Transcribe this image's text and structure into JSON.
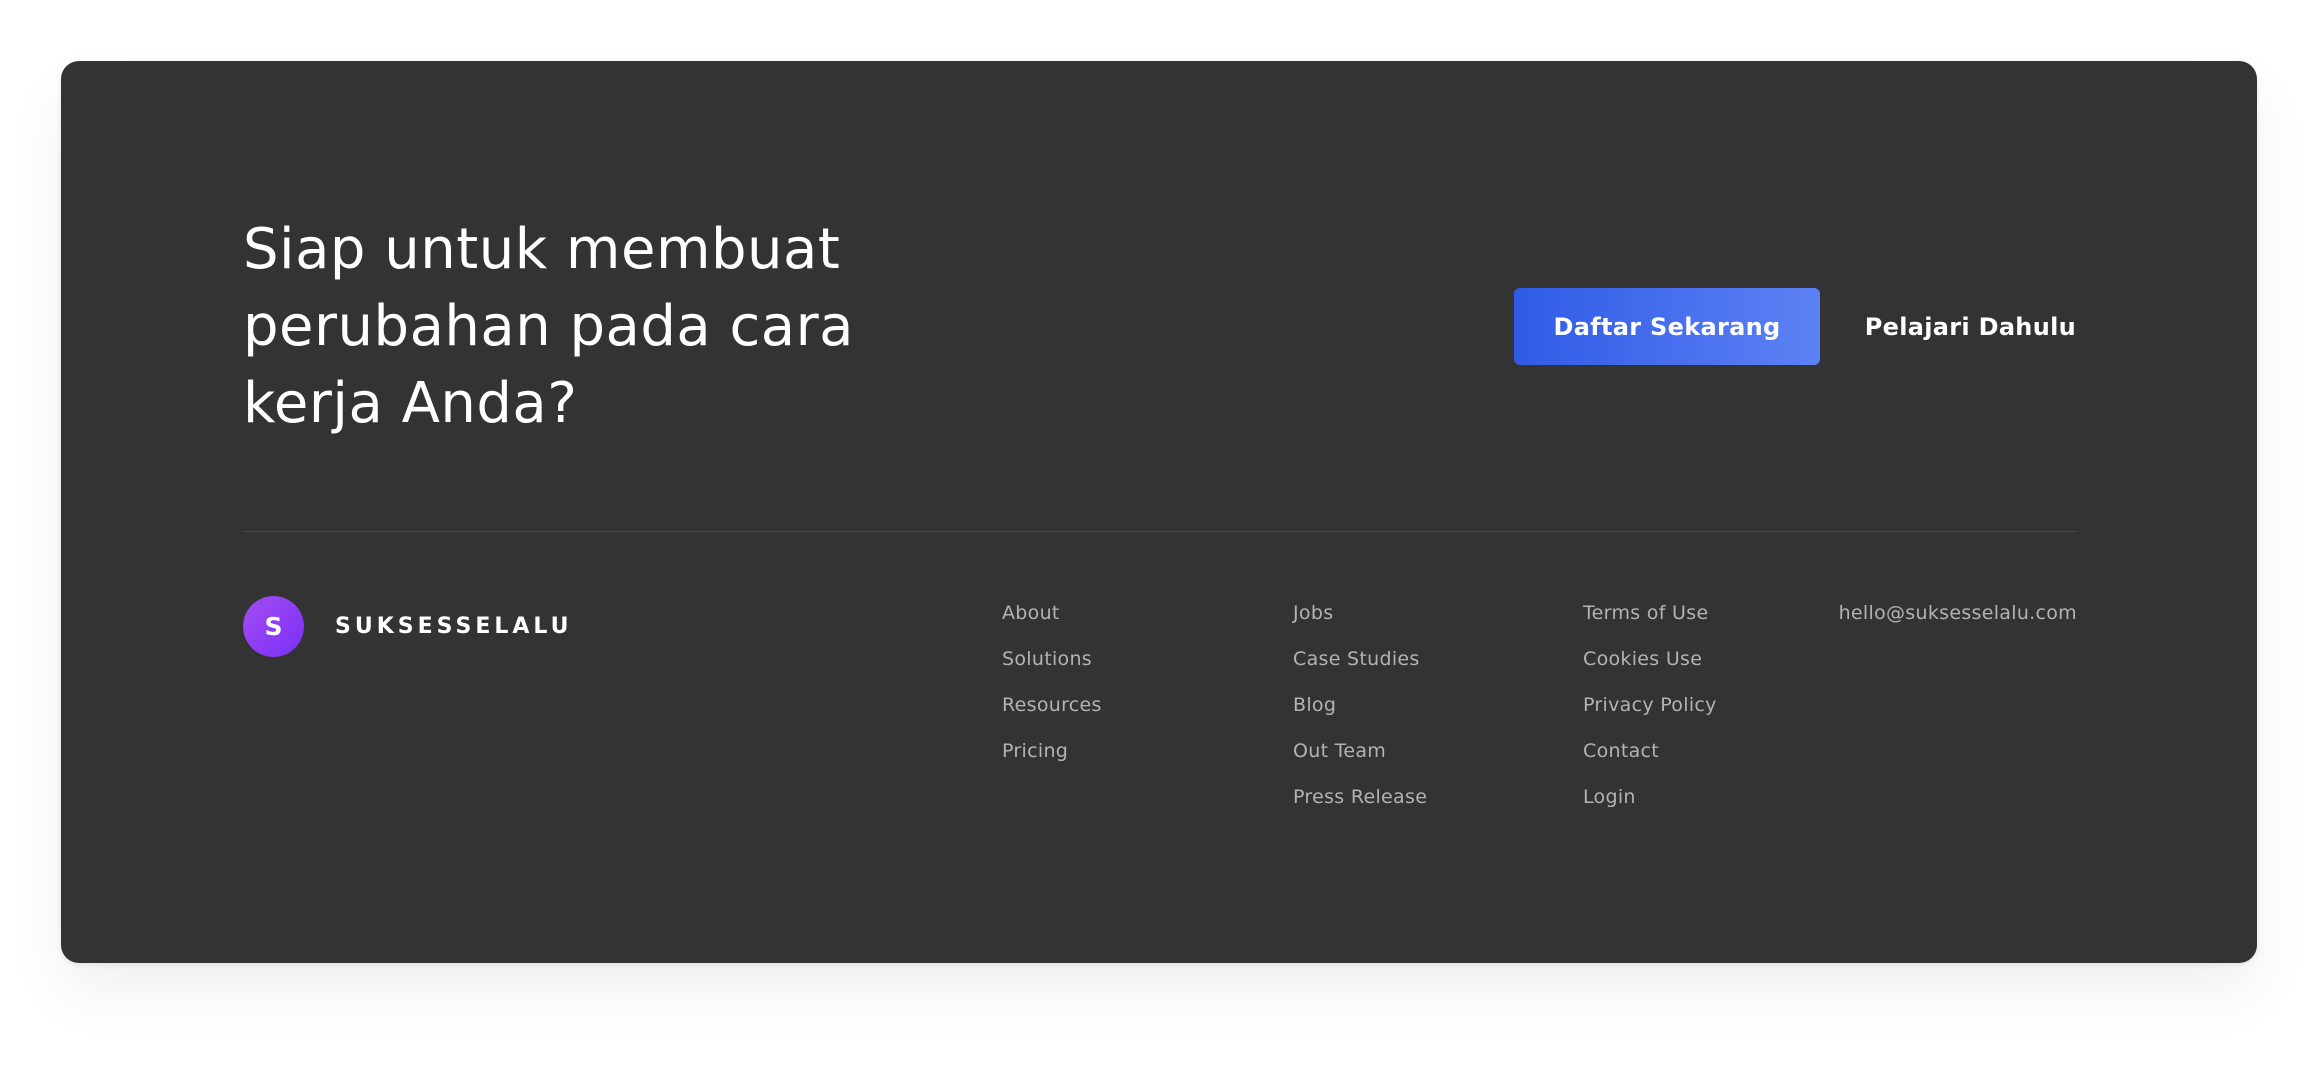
{
  "colors": {
    "page_background": "#ffffff",
    "card_background": "#333333",
    "primary_button_start": "#2f5be6",
    "primary_button_end": "#5d82f5",
    "logo_start": "#a24df2",
    "logo_end": "#7b2ff7",
    "link_text": "#b3b3b3",
    "heading_text": "#ffffff"
  },
  "cta": {
    "heading_lines": [
      "Siap untuk membuat",
      "perubahan pada cara",
      "kerja Anda?"
    ],
    "primary_button_label": "Daftar Sekarang",
    "secondary_link_label": "Pelajari Dahulu"
  },
  "brand": {
    "logo_letter": "S",
    "name": "SUKSESSELALU"
  },
  "footer": {
    "columns": [
      {
        "links": [
          "About",
          "Solutions",
          "Resources",
          "Pricing"
        ]
      },
      {
        "links": [
          "Jobs",
          "Case Studies",
          "Blog",
          "Out Team",
          "Press Release"
        ]
      },
      {
        "links": [
          "Terms of Use",
          "Cookies Use",
          "Privacy Policy",
          "Contact",
          "Login"
        ]
      }
    ],
    "email": "hello@suksesselalu.com"
  }
}
